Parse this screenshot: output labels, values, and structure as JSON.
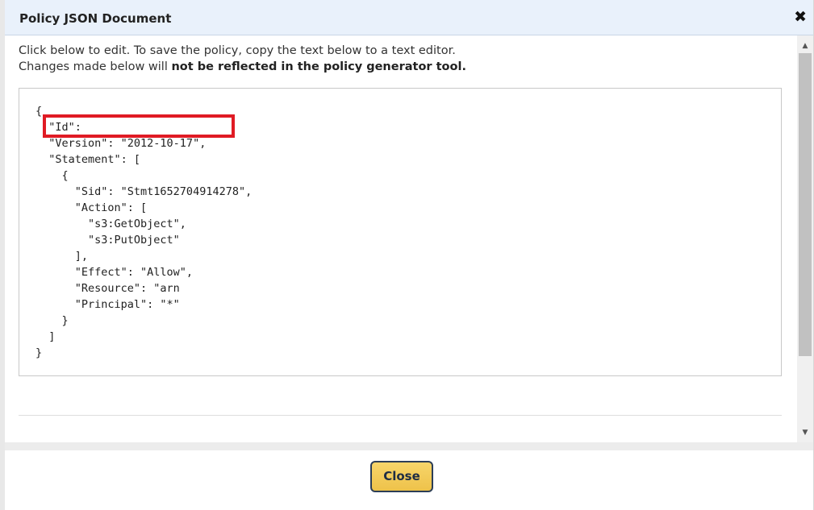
{
  "dialog": {
    "title": "Policy JSON Document",
    "close_icon": "close-icon",
    "close_symbol": "✖"
  },
  "intro": {
    "line1": "Click below to edit. To save the policy, copy the text below to a text editor.",
    "line2_prefix": "Changes made below will ",
    "line2_bold": "not be reflected in the policy generator tool."
  },
  "editor": {
    "code": "{\n  \"Id\":\n  \"Version\": \"2012-10-17\",\n  \"Statement\": [\n    {\n      \"Sid\": \"Stmt1652704914278\",\n      \"Action\": [\n        \"s3:GetObject\",\n        \"s3:PutObject\"\n      ],\n      \"Effect\": \"Allow\",\n      \"Resource\": \"arn\n      \"Principal\": \"*\"\n    }\n  ]\n}",
    "highlight_color": "#e01b24"
  },
  "scrollbar": {
    "up_icon": "scroll-up-arrow-icon",
    "down_icon": "scroll-down-arrow-icon",
    "up_symbol": "▲",
    "down_symbol": "▼"
  },
  "footer": {
    "close_label": "Close",
    "button_color": "#f2c94c"
  }
}
